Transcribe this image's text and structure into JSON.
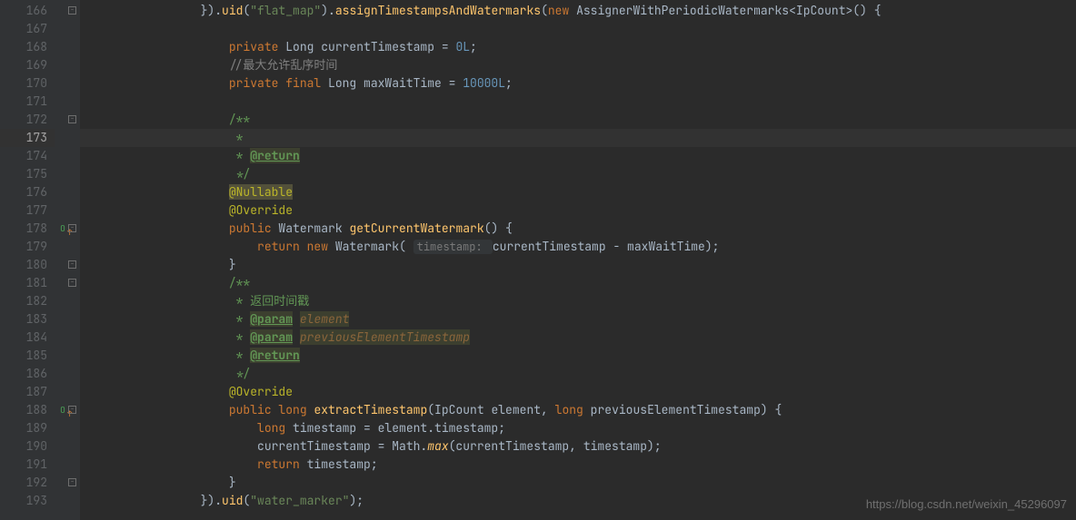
{
  "lines": [
    {
      "n": 166,
      "fold": "-"
    },
    {
      "n": 167
    },
    {
      "n": 168
    },
    {
      "n": 169
    },
    {
      "n": 170
    },
    {
      "n": 171
    },
    {
      "n": 172,
      "fold": "-"
    },
    {
      "n": 173,
      "current": true
    },
    {
      "n": 174
    },
    {
      "n": 175
    },
    {
      "n": 176
    },
    {
      "n": 177
    },
    {
      "n": 178,
      "override": true,
      "fold": "-"
    },
    {
      "n": 179
    },
    {
      "n": 180,
      "fold": "-"
    },
    {
      "n": 181,
      "fold": "-"
    },
    {
      "n": 182
    },
    {
      "n": 183
    },
    {
      "n": 184
    },
    {
      "n": 185
    },
    {
      "n": 186
    },
    {
      "n": 187
    },
    {
      "n": 188,
      "override": true,
      "fold": "-"
    },
    {
      "n": 189
    },
    {
      "n": 190
    },
    {
      "n": 191
    },
    {
      "n": 192,
      "fold": "-"
    },
    {
      "n": 193
    }
  ],
  "code": {
    "l166_pre": "                 }).",
    "l166_uid": "uid",
    "l166_p1": "(",
    "l166_str1": "\"flat_map\"",
    "l166_p2": ").",
    "l166_m2": "assignTimestampsAndWatermarks",
    "l166_p3": "(",
    "l166_kw": "new ",
    "l166_type": "AssignerWithPeriodicWatermarks",
    "l166_gen": "<IpCount>() {",
    "l168_pre": "                     ",
    "l168_kw": "private ",
    "l168_type": "Long ",
    "l168_var": "currentTimestamp = ",
    "l168_num": "0L",
    "l168_end": ";",
    "l169_pre": "                     ",
    "l169_comment": "//最大允许乱序时间",
    "l170_pre": "                     ",
    "l170_kw": "private final ",
    "l170_type": "Long ",
    "l170_var": "maxWaitTime = ",
    "l170_num": "10000L",
    "l170_end": ";",
    "l172_pre": "                     ",
    "l172_doc": "/**",
    "l173_pre": "                      ",
    "l173_doc": "*",
    "l174_pre": "                      ",
    "l174_doc": "* ",
    "l174_tag": "@return",
    "l175_pre": "                      ",
    "l175_doc": "*/",
    "l176_pre": "                     ",
    "l176_ann": "@Nullable",
    "l177_pre": "                     ",
    "l177_ann": "@Override",
    "l178_pre": "                     ",
    "l178_kw": "public ",
    "l178_type": "Watermark ",
    "l178_method": "getCurrentWatermark",
    "l178_end": "() {",
    "l179_pre": "                         ",
    "l179_kw": "return new ",
    "l179_type": "Watermark",
    "l179_p1": "( ",
    "l179_hint": "timestamp: ",
    "l179_expr": "currentTimestamp - maxWaitTime);",
    "l180_pre": "                     ",
    "l180_brace": "}",
    "l181_pre": "                     ",
    "l181_doc": "/**",
    "l182_pre": "                      ",
    "l182_doc": "* 返回时间戳",
    "l183_pre": "                      ",
    "l183_doc": "* ",
    "l183_tag": "@param",
    "l183_sp": " ",
    "l183_param": "element",
    "l184_pre": "                      ",
    "l184_doc": "* ",
    "l184_tag": "@param",
    "l184_sp": " ",
    "l184_param": "previousElementTimestamp",
    "l185_pre": "                      ",
    "l185_doc": "* ",
    "l185_tag": "@return",
    "l186_pre": "                      ",
    "l186_doc": "*/",
    "l187_pre": "                     ",
    "l187_ann": "@Override",
    "l188_pre": "                     ",
    "l188_kw1": "public ",
    "l188_kw2": "long ",
    "l188_method": "extractTimestamp",
    "l188_p1": "(IpCount element, ",
    "l188_kw3": "long ",
    "l188_p2": "previousElementTimestamp) {",
    "l189_pre": "                         ",
    "l189_kw": "long ",
    "l189_expr": "timestamp = element.timestamp;",
    "l190_pre": "                         ",
    "l190_expr1": "currentTimestamp = Math.",
    "l190_method": "max",
    "l190_expr2": "(currentTimestamp, timestamp);",
    "l191_pre": "                         ",
    "l191_kw": "return ",
    "l191_expr": "timestamp;",
    "l192_pre": "                     ",
    "l192_brace": "}",
    "l193_pre": "                 ",
    "l193_brace": "}).",
    "l193_uid": "uid",
    "l193_p1": "(",
    "l193_str": "\"water_marker\"",
    "l193_end": ");"
  },
  "watermark": "https://blog.csdn.net/weixin_45296097"
}
